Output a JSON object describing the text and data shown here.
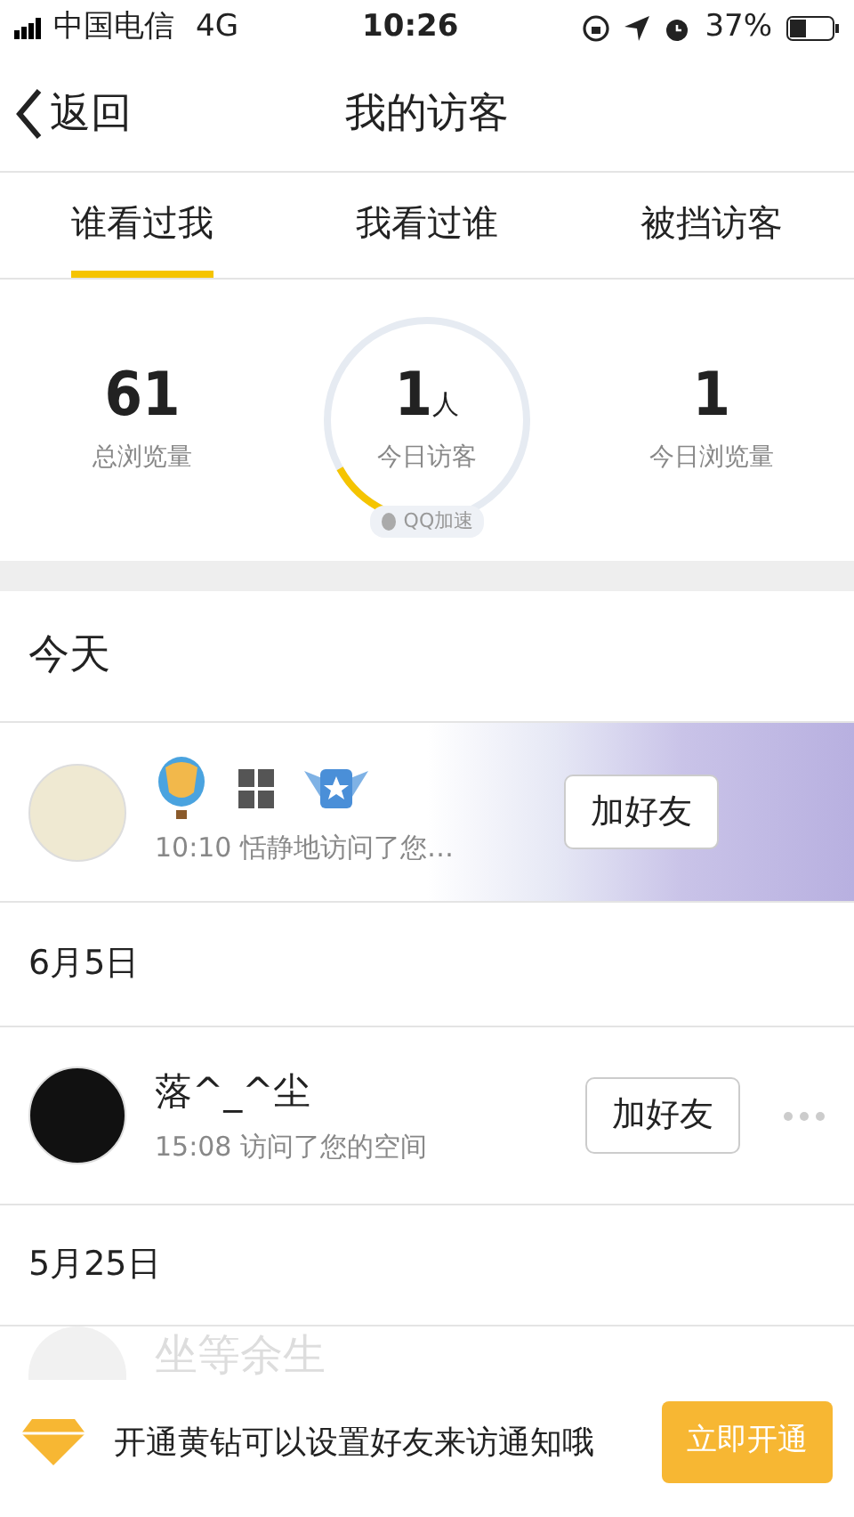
{
  "status_bar": {
    "carrier": "中国电信",
    "network": "4G",
    "time": "10:26",
    "battery": "37%"
  },
  "nav": {
    "back": "返回",
    "title": "我的访客"
  },
  "tabs": [
    {
      "label": "谁看过我",
      "selected": true
    },
    {
      "label": "我看过谁",
      "selected": false
    },
    {
      "label": "被挡访客",
      "selected": false
    }
  ],
  "stats": {
    "total": {
      "value": "61",
      "label": "总浏览量"
    },
    "today_visitors": {
      "value": "1",
      "unit": "人",
      "label": "今日访客",
      "level": 0.1,
      "badge": "QQ加速"
    },
    "today_views": {
      "value": "1",
      "label": "今日浏览量"
    }
  },
  "groups": [
    {
      "date": "今天",
      "visitors": [
        {
          "kind": "decorated",
          "status": "10:10 恬静地访问了您…",
          "action": "加好友",
          "more_menu": false
        }
      ]
    },
    {
      "date": "6月5日",
      "visitors": [
        {
          "kind": "plain",
          "name": "落^_^尘",
          "status": "15:08 访问了您的空间",
          "action": "加好友",
          "more_menu": true
        }
      ]
    },
    {
      "date": "5月25日",
      "visitors": [
        {
          "kind": "faded",
          "name": "坐等余生"
        }
      ]
    }
  ],
  "promo": {
    "text": "开通黄钻可以设置好友来访通知哦",
    "button": "立即开通"
  }
}
